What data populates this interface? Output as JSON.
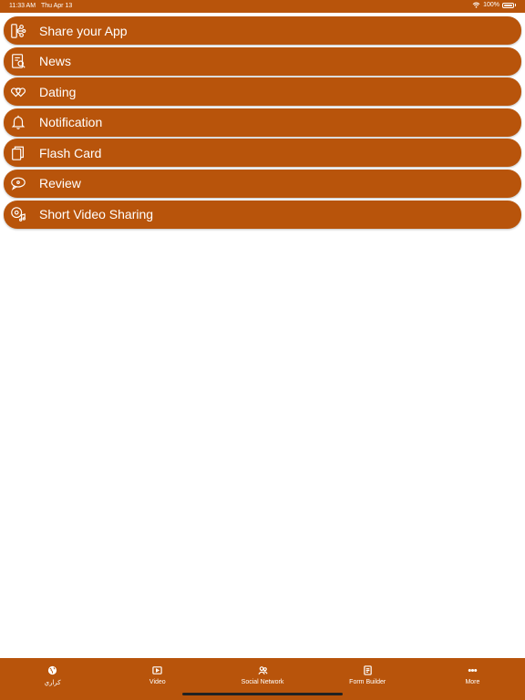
{
  "status_bar": {
    "time": "11:33 AM",
    "date": "Thu Apr 13",
    "battery": "100%"
  },
  "menu": {
    "items": [
      {
        "label": "Share your App",
        "icon": "share-app-icon"
      },
      {
        "label": "News",
        "icon": "news-icon"
      },
      {
        "label": "Dating",
        "icon": "dating-hearts-icon"
      },
      {
        "label": "Notification",
        "icon": "bell-icon"
      },
      {
        "label": "Flash Card",
        "icon": "flash-card-icon"
      },
      {
        "label": "Review",
        "icon": "review-bubble-icon"
      },
      {
        "label": "Short Video Sharing",
        "icon": "video-music-icon"
      }
    ]
  },
  "tabs": [
    {
      "label": "كراري",
      "icon": "globe-icon"
    },
    {
      "label": "Video",
      "icon": "video-icon"
    },
    {
      "label": "Social Network",
      "icon": "people-icon"
    },
    {
      "label": "Form Builder",
      "icon": "form-icon"
    },
    {
      "label": "More",
      "icon": "more-dots-icon"
    }
  ],
  "colors": {
    "accent": "#b8540b",
    "text": "#ffffff",
    "background": "#ffffff"
  }
}
